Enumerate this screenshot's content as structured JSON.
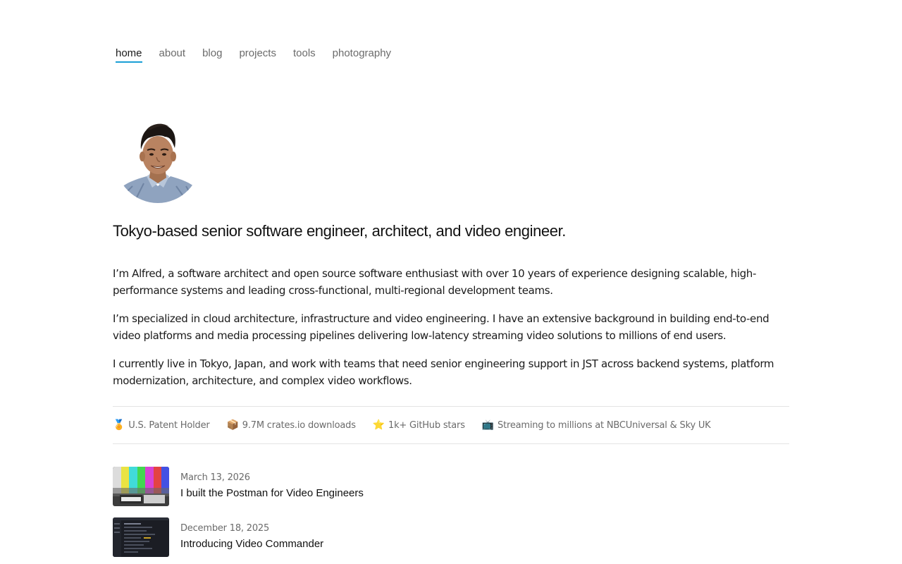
{
  "nav": {
    "items": [
      {
        "label": "home",
        "active": true
      },
      {
        "label": "about",
        "active": false
      },
      {
        "label": "blog",
        "active": false
      },
      {
        "label": "projects",
        "active": false
      },
      {
        "label": "tools",
        "active": false
      },
      {
        "label": "photography",
        "active": false
      }
    ],
    "accent_color": "#1a9fd6"
  },
  "hero": {
    "headline": "Tokyo-based senior software engineer, architect, and video engineer.",
    "bio": [
      "I’m Alfred, a software architect and open source software enthusiast with over 10 years of experience designing scalable, high-performance systems and leading cross-functional, multi-regional development teams.",
      "I’m specialized in cloud architecture, infrastructure and video engineering. I have an extensive background in building end-to-end video platforms and media processing pipelines delivering low-latency streaming video solutions to millions of end users.",
      "I currently live in Tokyo, Japan, and work with teams that need senior engineering support in JST across backend systems, platform modernization, architecture, and complex video workflows."
    ]
  },
  "highlights": [
    {
      "emoji": "🏅",
      "icon": "medal-icon",
      "text": "U.S. Patent Holder"
    },
    {
      "emoji": "📦",
      "icon": "package-icon",
      "text": "9.7M crates.io downloads"
    },
    {
      "emoji": "⭐",
      "icon": "star-icon",
      "text": "1k+ GitHub stars"
    },
    {
      "emoji": "📺",
      "icon": "tv-icon",
      "text": "Streaming to millions at NBCUniversal & Sky UK"
    }
  ],
  "posts": [
    {
      "date": "March 13, 2026",
      "title": "I built the Postman for Video Engineers",
      "thumb": "color-bars-thumbnail"
    },
    {
      "date": "December 18, 2025",
      "title": "Introducing Video Commander",
      "thumb": "app-screenshot-thumbnail"
    }
  ]
}
